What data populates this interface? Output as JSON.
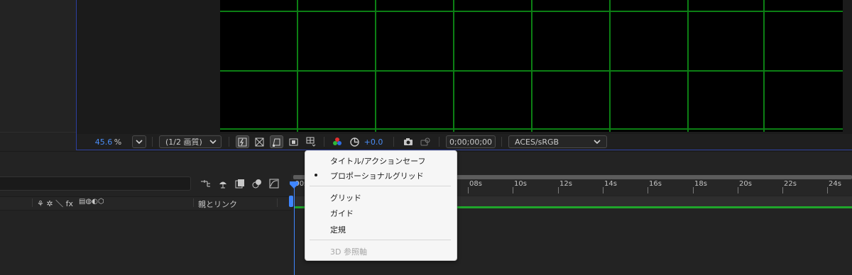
{
  "viewer": {
    "zoom_value": "45.6",
    "zoom_unit": "%",
    "resolution": "(1/2 画質)",
    "exposure": "+0.0",
    "timecode": "0;00;00;00",
    "color_space": "ACES/sRGB",
    "grid_color": "#0c7f14",
    "accent_color": "#4a8cf5"
  },
  "popup_menu": {
    "items": [
      {
        "label": "タイトル/アクションセーフ",
        "checked": false,
        "enabled": true
      },
      {
        "label": "プロポーショナルグリッド",
        "checked": true,
        "enabled": true
      },
      {
        "label": "グリッド",
        "checked": false,
        "enabled": true
      },
      {
        "label": "ガイド",
        "checked": false,
        "enabled": true
      },
      {
        "label": "定規",
        "checked": false,
        "enabled": true
      },
      {
        "label": "3D 参照軸",
        "checked": false,
        "enabled": false
      }
    ]
  },
  "timeline": {
    "parent_link_label": "親とリンク",
    "switch_icons": "⚘ ✲ ＼ fx",
    "ruler_start": ":00s",
    "ruler_labels": [
      "08s",
      "10s",
      "12s",
      "14s",
      "16s",
      "18s",
      "20s",
      "22s",
      "24s"
    ],
    "layer_bar_color": "#1fa52b",
    "playhead_color": "#3f86ff"
  }
}
